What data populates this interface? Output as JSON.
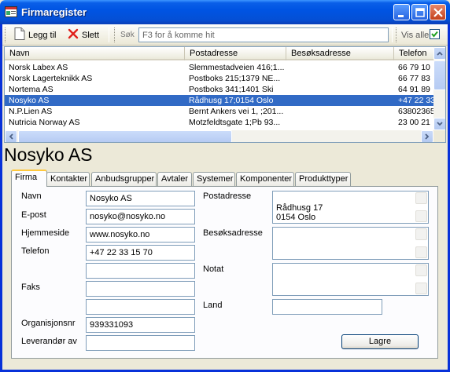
{
  "window": {
    "title": "Firmaregister"
  },
  "toolbar": {
    "add_label": "Legg til",
    "delete_label": "Slett",
    "search_label": "Søk",
    "search_placeholder": "F3 for å komme hit",
    "show_all_label": "Vis alle",
    "show_all_checked": true
  },
  "list": {
    "columns": [
      "Navn",
      "Postadresse",
      "Besøksadresse",
      "Telefon"
    ],
    "rows": [
      [
        "Norsk Labex AS",
        "Slemmestadveien 416;1...",
        "",
        "66 79 10"
      ],
      [
        "Norsk Lagerteknikk AS",
        "Postboks 215;1379 NE...",
        "",
        "66 77 83"
      ],
      [
        "Nortema AS",
        "Postboks 341;1401 Ski",
        "",
        "64 91 89"
      ],
      [
        "Nosyko AS",
        "Rådhusg 17;0154 Oslo",
        "",
        "+47 22 33"
      ],
      [
        "N.P.Lien AS",
        "Bernt Ankers vei 1, ;201...",
        "",
        "63802365"
      ],
      [
        "Nutricia Norway AS",
        "Motzfeldtsgate 1;Pb 93...",
        "",
        "23 00 21"
      ]
    ],
    "selected_index": 3
  },
  "detail": {
    "title": "Nosyko AS",
    "tabs": [
      "Firma",
      "Kontakter",
      "Anbudsgrupper",
      "Avtaler",
      "Systemer",
      "Komponenter",
      "Produkttyper"
    ],
    "active_tab": 0,
    "labels": {
      "navn": "Navn",
      "epost": "E-post",
      "hjemmeside": "Hjemmeside",
      "telefon": "Telefon",
      "faks": "Faks",
      "orgnr": "Organisjonsnr",
      "leverandor": "Leverandør av",
      "postadresse": "Postadresse",
      "besoksadresse": "Besøksadresse",
      "notat": "Notat",
      "land": "Land"
    },
    "values": {
      "navn": "Nosyko AS",
      "epost": "nosyko@nosyko.no",
      "hjemmeside": "www.nosyko.no",
      "telefon": "+47 22 33 15 70",
      "telefon2": "",
      "faks": "",
      "faks2": "",
      "orgnr": "939331093",
      "leverandor": "",
      "postadresse": "Rådhusg 17\n0154 Oslo",
      "besoksadresse": "",
      "notat": "",
      "land": ""
    },
    "save_label": "Lagre"
  }
}
